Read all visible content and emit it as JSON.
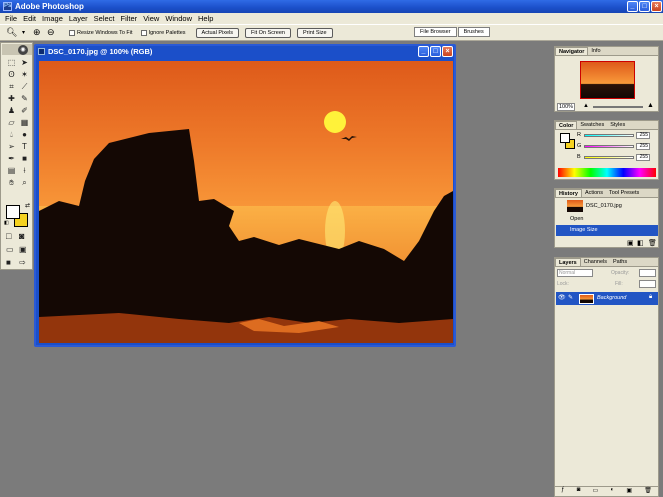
{
  "app": {
    "title": "Adobe Photoshop",
    "ps_badge": "Ps"
  },
  "window_controls": {
    "minimize": "_",
    "maximize": "□",
    "close": "×"
  },
  "menu": [
    "File",
    "Edit",
    "Image",
    "Layer",
    "Select",
    "Filter",
    "View",
    "Window",
    "Help"
  ],
  "options": {
    "resize_windows": "Resize Windows To Fit",
    "ignore_palettes": "Ignore Palettes",
    "actual_pixels": "Actual Pixels",
    "fit_on_screen": "Fit On Screen",
    "print_size": "Print Size"
  },
  "well_tabs": [
    "File Browser",
    "Brushes"
  ],
  "document": {
    "title": "DSC_0170.jpg @ 100% (RGB)"
  },
  "navigator": {
    "tabs": [
      "Navigator",
      "Info"
    ],
    "zoom": "100%"
  },
  "color": {
    "tabs": [
      "Color",
      "Swatches",
      "Styles"
    ],
    "r_label": "R",
    "g_label": "G",
    "b_label": "B",
    "r": "255",
    "g": "255",
    "b": "255"
  },
  "history": {
    "tabs": [
      "History",
      "Actions",
      "Tool Presets"
    ],
    "snapshot": "DSC_0170.jpg",
    "items": [
      "Open",
      "Image Size"
    ]
  },
  "layers": {
    "tabs": [
      "Layers",
      "Channels",
      "Paths"
    ],
    "blend": "Normal",
    "opacity_label": "Opacity:",
    "lock_label": "Lock:",
    "fill_label": "Fill:",
    "layer_name": "Background"
  },
  "colors": {
    "titlebar": "#1b4fc9",
    "chrome": "#ece9d8",
    "workspace": "#7b7b7b",
    "background_swatch": "#f5d220"
  }
}
